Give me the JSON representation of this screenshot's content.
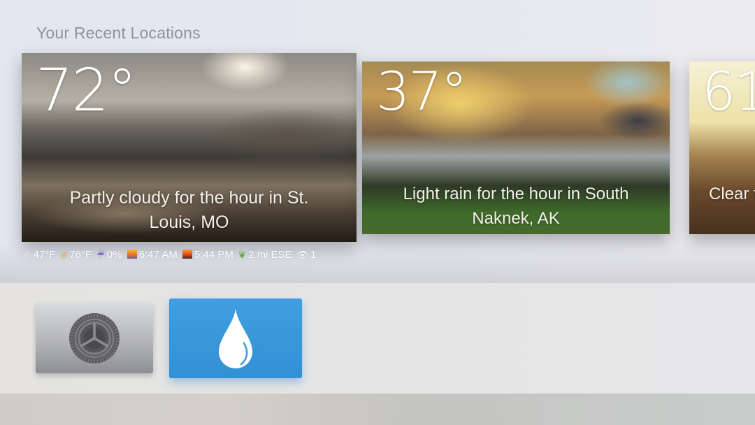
{
  "section_title": "Your Recent Locations",
  "locations": [
    {
      "temperature": "72°",
      "summary_line1": "Partly cloudy for the hour in St.",
      "summary_line2": "Louis, MO",
      "focused": true
    },
    {
      "temperature": "37°",
      "summary_line1": "Light rain for the hour in South",
      "summary_line2": "Naknek, AK",
      "focused": false
    },
    {
      "temperature": "61",
      "summary_line1": "Clear f",
      "focused": false
    }
  ],
  "details": {
    "low_icon": "snowman-icon",
    "low": "47°F",
    "high_icon": "fire-icon",
    "high": "76°F",
    "precip_icon": "umbrella-rain-icon",
    "precip": "0%",
    "sunrise_icon": "sunrise-icon",
    "sunrise": "6:47 AM",
    "sunset_icon": "sunset-city-icon",
    "sunset": "5:44 PM",
    "wind_icon": "leaves-wind-icon",
    "wind": "2 mi ESE",
    "visibility_icon": "eye-icon",
    "visibility": "1"
  },
  "dock": {
    "apps": [
      {
        "name": "Settings",
        "icon": "gear-icon"
      },
      {
        "name": "Weather",
        "icon": "water-drop-icon",
        "focused": true,
        "color": "#3a98dc"
      }
    ]
  }
}
